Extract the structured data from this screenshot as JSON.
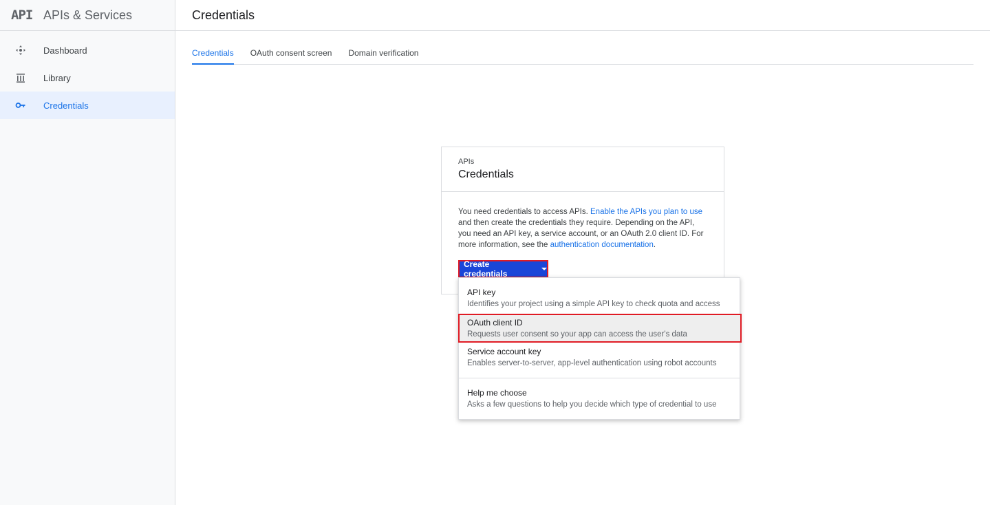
{
  "brand": {
    "logo": "API",
    "title": "APIs & Services"
  },
  "sidebar": {
    "items": [
      {
        "label": "Dashboard",
        "icon": "dashboard-icon"
      },
      {
        "label": "Library",
        "icon": "library-icon"
      },
      {
        "label": "Credentials",
        "icon": "key-icon",
        "active": true
      }
    ]
  },
  "header": {
    "title": "Credentials"
  },
  "tabs": [
    {
      "label": "Credentials",
      "active": true
    },
    {
      "label": "OAuth consent screen"
    },
    {
      "label": "Domain verification"
    }
  ],
  "card": {
    "eyebrow": "APIs",
    "title": "Credentials",
    "text_1": "You need credentials to access APIs. ",
    "link_1": "Enable the APIs you plan to use",
    "text_2": " and then create the credentials they require. Depending on the API, you need an API key, a service account, or an OAuth 2.0 client ID. For more information, see the ",
    "link_2": "authentication documentation",
    "text_3": "."
  },
  "create_button": {
    "label": "Create credentials"
  },
  "menu": {
    "items": [
      {
        "title": "API key",
        "description": "Identifies your project using a simple API key to check quota and access"
      },
      {
        "title": "OAuth client ID",
        "description": "Requests user consent so your app can access the user's data"
      },
      {
        "title": "Service account key",
        "description": "Enables server-to-server, app-level authentication using robot accounts"
      },
      {
        "title": "Help me choose",
        "description": "Asks a few questions to help you decide which type of credential to use"
      }
    ]
  },
  "colors": {
    "accent": "#1a73e8",
    "button": "#1a46d8",
    "highlight_border": "#e01b24"
  }
}
